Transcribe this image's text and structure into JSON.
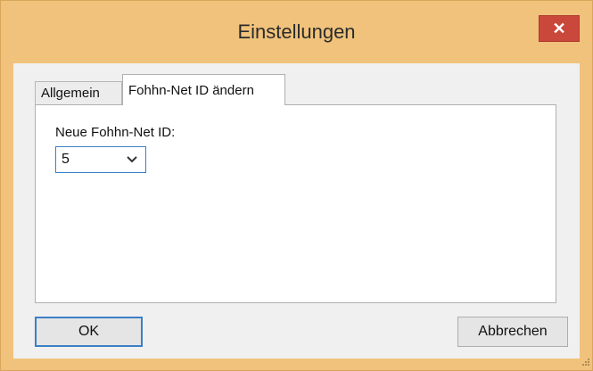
{
  "window": {
    "title": "Einstellungen",
    "close_glyph": "✕"
  },
  "tabs": [
    {
      "label": "Allgemein",
      "active": false
    },
    {
      "label": "Fohhn-Net ID ändern",
      "active": true
    }
  ],
  "panel": {
    "field_label": "Neue Fohhn-Net ID:",
    "select_value": "5",
    "select_icon": "chevron-down-icon"
  },
  "buttons": {
    "ok": "OK",
    "cancel": "Abbrechen"
  },
  "colors": {
    "title_bar": "#f0c27b",
    "close_button": "#c9473b",
    "focus_border": "#3c7fc8",
    "client_bg": "#f0f0f0"
  }
}
